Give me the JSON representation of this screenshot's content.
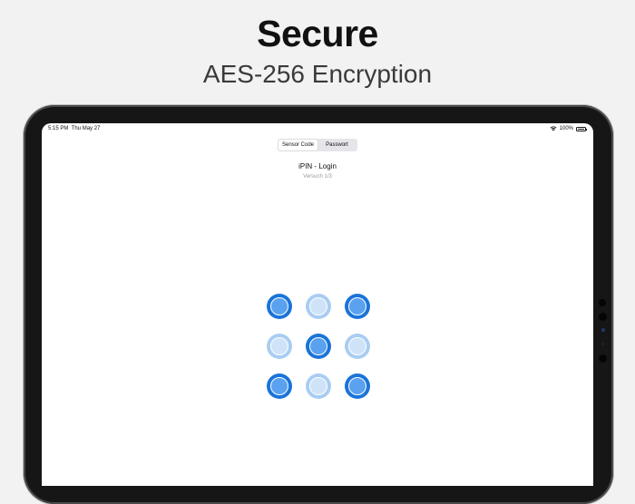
{
  "marketing": {
    "headline": "Secure",
    "subheadline": "AES-256 Encryption"
  },
  "status_bar": {
    "time": "5:15 PM",
    "date": "Thu May 27",
    "battery_text": "100%",
    "battery_level": 1.0
  },
  "auth_tabs": {
    "items": [
      {
        "label": "Sensor Code",
        "selected": true
      },
      {
        "label": "Passwort",
        "selected": false
      }
    ]
  },
  "login": {
    "title": "iPIN - Login",
    "attempt": "Versuch 1/3"
  },
  "pattern_grid": {
    "rows": 3,
    "cols": 3,
    "states": [
      "on",
      "off",
      "on",
      "off",
      "on",
      "off",
      "on",
      "off",
      "on"
    ]
  },
  "colors": {
    "node_on": "#1a74d8",
    "node_off": "#a9cdf2",
    "background": "#f2f2f2"
  }
}
